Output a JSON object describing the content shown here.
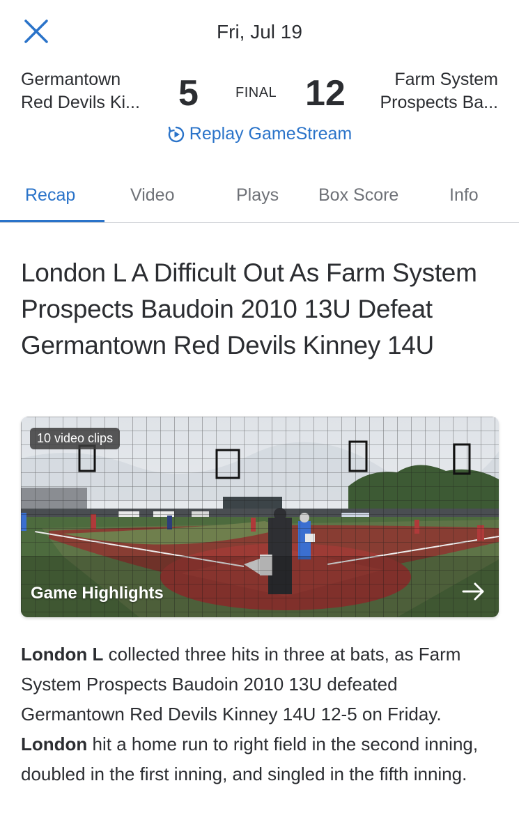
{
  "header": {
    "date": "Fri, Jul 19"
  },
  "game": {
    "home_team_line1": "Germantown",
    "home_team_line2": "Red Devils Ki...",
    "home_score": "5",
    "status": "FINAL",
    "away_score": "12",
    "away_team_line1": "Farm System",
    "away_team_line2": "Prospects Ba..."
  },
  "replay_label": "Replay GameStream",
  "tabs": [
    {
      "label": "Recap",
      "active": true
    },
    {
      "label": "Video",
      "active": false
    },
    {
      "label": "Plays",
      "active": false
    },
    {
      "label": "Box Score",
      "active": false
    },
    {
      "label": "Info",
      "active": false
    }
  ],
  "article": {
    "headline": "London L A Difficult Out As Farm System Prospects Baudoin 2010 13U Defeat Germantown Red Devils Kinney 14U",
    "video": {
      "clips_badge": "10 video clips",
      "title": "Game Highlights"
    },
    "body": {
      "s1_bold": "London L",
      "s1_text": " collected three hits in three at bats, as Farm System Prospects Baudoin 2010 13U defeated Germantown Red Devils Kinney 14U 12-5 on Friday. ",
      "s2_bold": "London",
      "s2_text": " hit a home run to right field in the second inning, doubled in the first inning, and singled in the fifth inning."
    }
  },
  "colors": {
    "accent": "#2a73c9",
    "text": "#2b2d31",
    "muted": "#6e7177"
  },
  "icons": {
    "close": "close-icon",
    "replay": "replay-play-icon",
    "arrow": "arrow-right-icon"
  }
}
